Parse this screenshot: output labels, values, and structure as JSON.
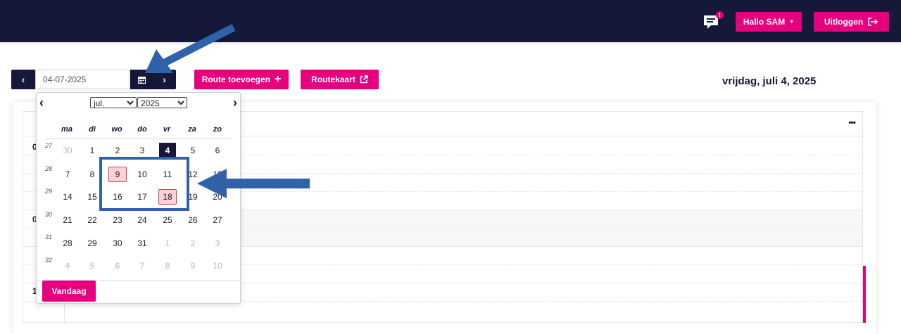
{
  "header": {
    "notification_badge": "!",
    "hello_label": "Hallo SAM",
    "logout_label": "Uitloggen"
  },
  "toolbar": {
    "date_value": "04-07-2025",
    "route_add_label": "Route toevoegen",
    "routekaart_label": "Routekaart",
    "date_title": "vrijdag, juli 4, 2025"
  },
  "datepicker": {
    "month": "jul.",
    "year": "2025",
    "weekdays": [
      "ma",
      "di",
      "wo",
      "do",
      "vr",
      "za",
      "zo"
    ],
    "weeks": [
      {
        "week": "27",
        "days": [
          "30",
          "1",
          "2",
          "3",
          "4",
          "5",
          "6"
        ]
      },
      {
        "week": "28",
        "days": [
          "7",
          "8",
          "9",
          "10",
          "11",
          "12",
          "13"
        ]
      },
      {
        "week": "29",
        "days": [
          "14",
          "15",
          "16",
          "17",
          "18",
          "19",
          "20"
        ]
      },
      {
        "week": "30",
        "days": [
          "21",
          "22",
          "23",
          "24",
          "25",
          "26",
          "27"
        ]
      },
      {
        "week": "31",
        "days": [
          "28",
          "29",
          "30",
          "31",
          "1",
          "2",
          "3"
        ]
      },
      {
        "week": "32",
        "days": [
          "4",
          "5",
          "6",
          "7",
          "8",
          "9",
          "10"
        ]
      }
    ],
    "today_label": "Vandaag"
  },
  "schedule": {
    "hour_labels": [
      "0",
      "0",
      "1"
    ],
    "more_icon": "more-horizontal-icon"
  },
  "colors": {
    "navy": "#151838",
    "pink": "#e6007e",
    "highlight_blue": "#2f62a8",
    "marked_day": "#fbd0d6"
  }
}
